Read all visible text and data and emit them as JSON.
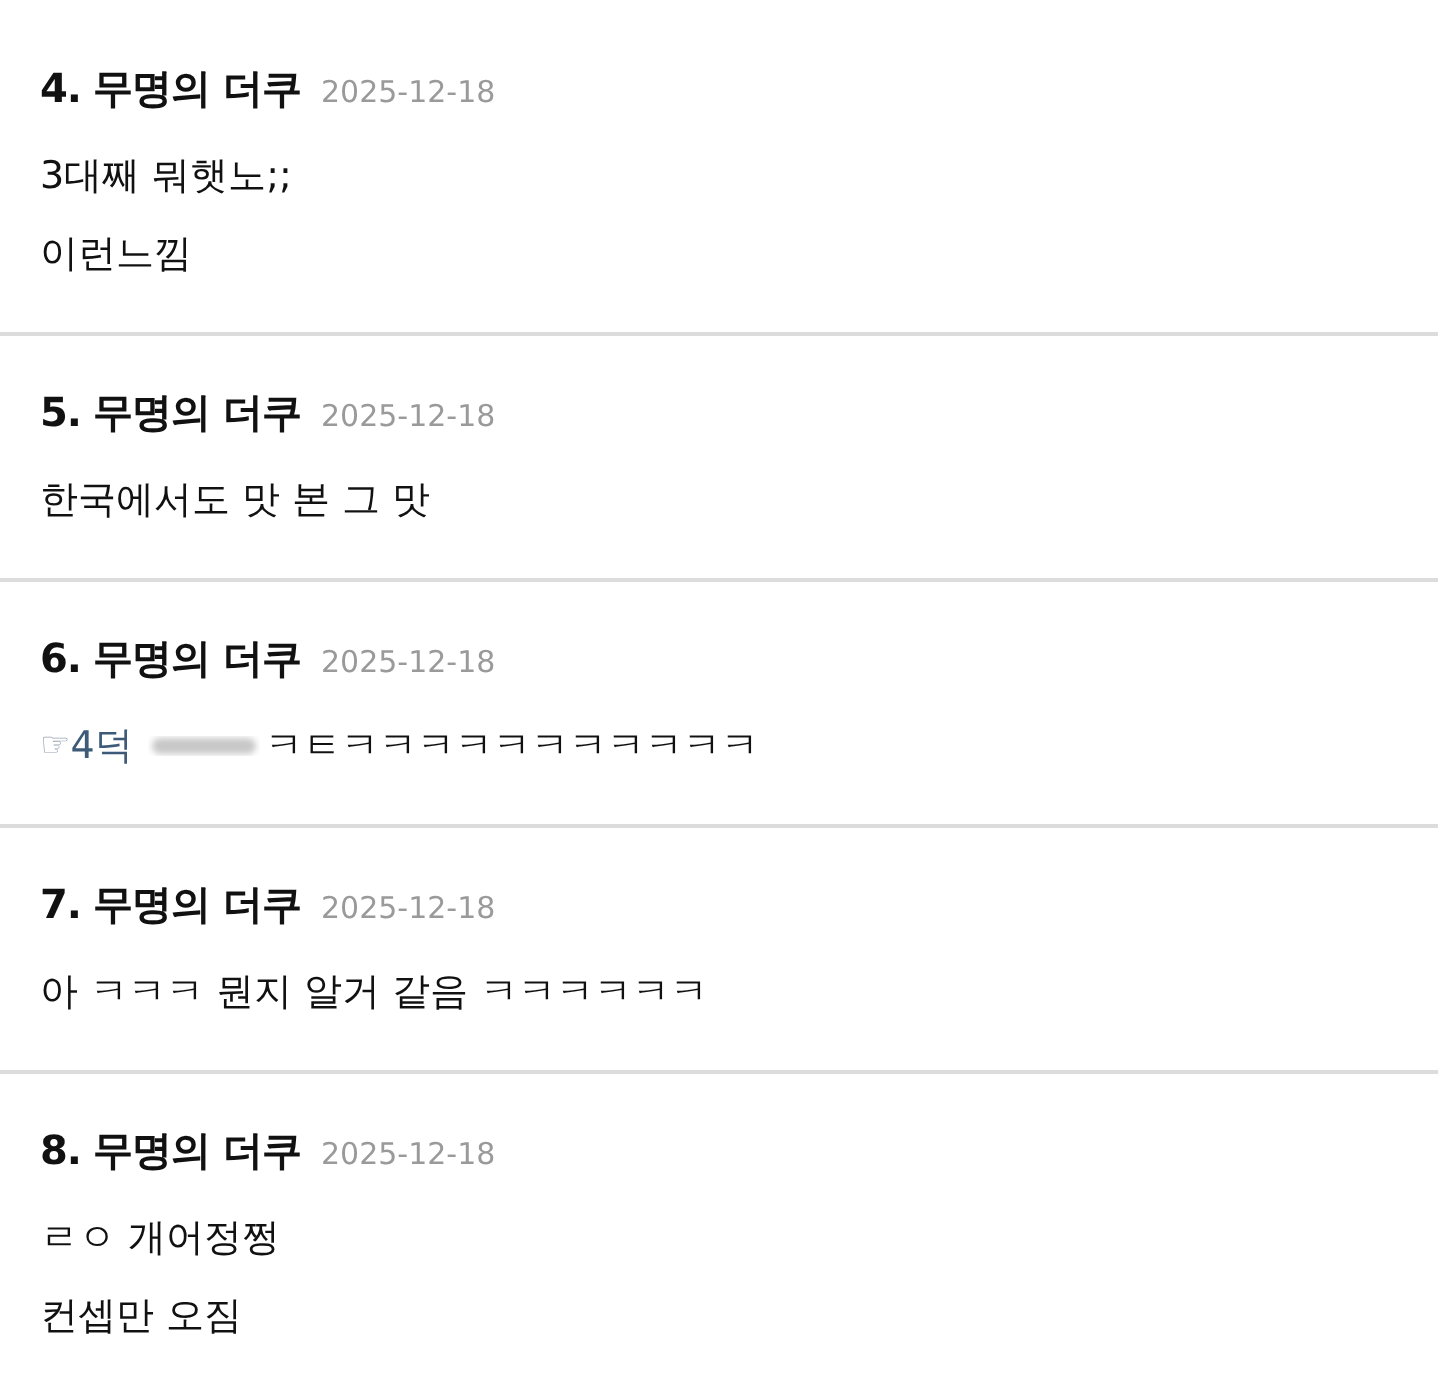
{
  "comments": [
    {
      "number": "4.",
      "author": "무명의 더쿠",
      "date": "2025-12-18",
      "lines": [
        "3대째 뭐햇노;;",
        "이런느낌"
      ]
    },
    {
      "number": "5.",
      "author": "무명의 더쿠",
      "date": "2025-12-18",
      "lines": [
        "한국에서도 맛 본 그 맛"
      ]
    },
    {
      "number": "6.",
      "author": "무명의 더쿠",
      "date": "2025-12-18",
      "reply_mark": "☞",
      "reply_to": "4덕",
      "redacted": true,
      "lines": [
        "ㅋㅌㅋㅋㅋㅋㅋㅋㅋㅋㅋㅋㅋ"
      ]
    },
    {
      "number": "7.",
      "author": "무명의 더쿠",
      "date": "2025-12-18",
      "lines": [
        "아 ㅋㅋㅋ 뭔지 알거 같음 ㅋㅋㅋㅋㅋㅋ"
      ]
    },
    {
      "number": "8.",
      "author": "무명의 더쿠",
      "date": "2025-12-18",
      "lines": [
        "ㄹㅇ 개어정쩡",
        "컨셉만 오짐"
      ]
    }
  ]
}
